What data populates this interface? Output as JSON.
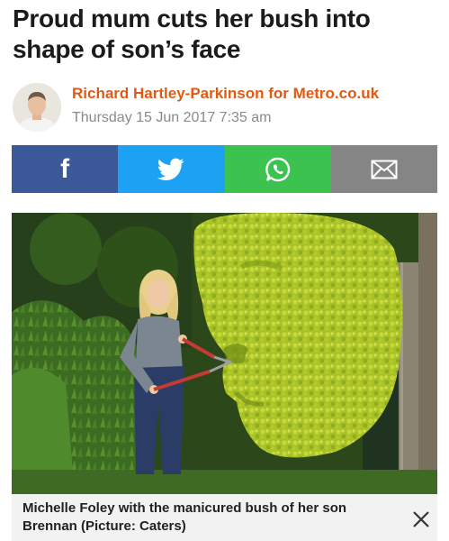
{
  "article": {
    "headline": "Proud mum cuts her bush into shape of son’s face",
    "author": "Richard Hartley-Parkinson",
    "for_word": "for",
    "publication": "Metro.co.uk",
    "date": "Thursday 15 Jun 2017 7:35 am"
  },
  "share": {
    "facebook_label": "f",
    "buttons": [
      "facebook-icon",
      "twitter-icon",
      "whatsapp-icon",
      "email-icon"
    ],
    "colors": {
      "facebook": "#3b5998",
      "twitter": "#1da1f2",
      "whatsapp": "#3cc24f",
      "email": "#858585"
    }
  },
  "photo": {
    "caption": "Michelle Foley with the manicured bush of her son Brennan (Picture: Caters)"
  },
  "theme": {
    "accent": "#e15a14"
  }
}
